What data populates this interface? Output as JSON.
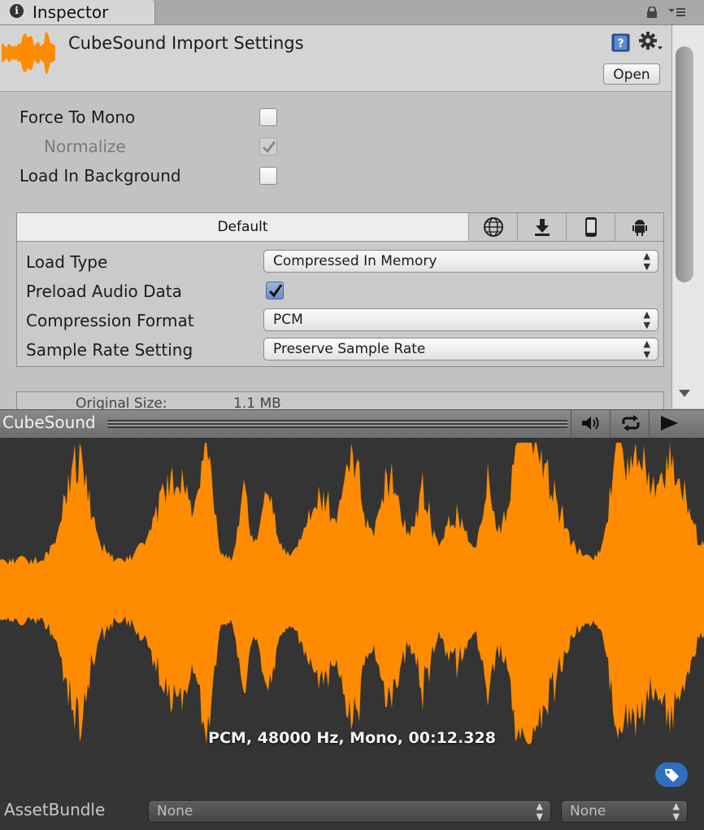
{
  "tab": {
    "label": "Inspector",
    "info_glyph": "i",
    "icons": [
      "info-icon",
      "lock-icon",
      "tab-menu-icon"
    ]
  },
  "header": {
    "title": "CubeSound Import Settings",
    "open_label": "Open",
    "icons": [
      "audio-file-icon",
      "help-icon",
      "gear-icon"
    ],
    "help_glyph": "?"
  },
  "settings": {
    "force_to_mono": {
      "label": "Force To Mono",
      "checked": false
    },
    "normalize": {
      "label": "Normalize",
      "checked": true,
      "enabled": false
    },
    "load_in_background": {
      "label": "Load In Background",
      "checked": false
    }
  },
  "platform": {
    "default_tab": "Default",
    "tabs": [
      "globe-icon",
      "download-icon",
      "phone-icon",
      "android-icon"
    ],
    "load_type": {
      "label": "Load Type",
      "value": "Compressed In Memory"
    },
    "preload_audio_data": {
      "label": "Preload Audio Data",
      "checked": true
    },
    "compression_format": {
      "label": "Compression Format",
      "value": "PCM"
    },
    "sample_rate_setting": {
      "label": "Sample Rate Setting",
      "value": "Preserve Sample Rate"
    }
  },
  "size_info": {
    "original_label": "Original Size:",
    "original_value": "1.1 MB"
  },
  "preview": {
    "title": "CubeSound",
    "buttons": [
      "speaker-icon",
      "loop-icon",
      "play-icon"
    ],
    "format_info": "PCM, 48000 Hz, Mono, 00:12.328",
    "waveform_color": "#ff8c00"
  },
  "asset_bundle": {
    "label": "AssetBundle",
    "name_value": "None",
    "variant_value": "None"
  },
  "colors": {
    "accent": "#ff8c00",
    "tag": "#2f6fc0",
    "checkbox_checked": "#6a8dc7"
  }
}
